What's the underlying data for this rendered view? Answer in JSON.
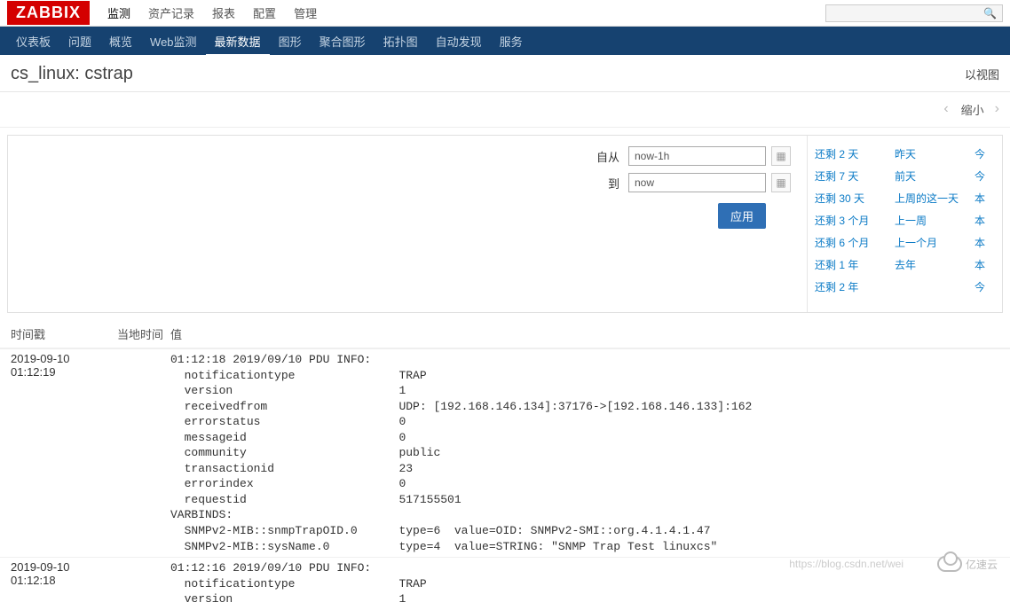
{
  "logo": "ZABBIX",
  "top_menu": [
    "监测",
    "资产记录",
    "报表",
    "配置",
    "管理"
  ],
  "top_active": 0,
  "sub_menu": [
    "仪表板",
    "问题",
    "概览",
    "Web监测",
    "最新数据",
    "图形",
    "聚合图形",
    "拓扑图",
    "自动发现",
    "服务"
  ],
  "sub_active": 4,
  "page_title": "cs_linux: cstrap",
  "view_mode": "以视图",
  "zoom_label": "缩小",
  "filter": {
    "from_label": "自从",
    "from_value": "now-1h",
    "to_label": "到",
    "to_value": "now",
    "apply": "应用"
  },
  "presets_left": [
    "还剩 2 天",
    "还剩 7 天",
    "还剩 30 天",
    "还剩 3 个月",
    "还剩 6 个月",
    "还剩 1 年",
    "还剩 2 年"
  ],
  "presets_right": [
    "昨天",
    "前天",
    "上周的这一天",
    "上一周",
    "上一个月",
    "去年",
    ""
  ],
  "presets_extra": [
    "今",
    "今",
    "本",
    "本",
    "本",
    "本",
    "今"
  ],
  "table": {
    "headers": {
      "ts": "时间戳",
      "local": "当地时间",
      "val": "值"
    },
    "rows": [
      {
        "ts": "2019-09-10 01:12:19",
        "local": "",
        "value": "01:12:18 2019/09/10 PDU INFO:\n  notificationtype               TRAP\n  version                        1\n  receivedfrom                   UDP: [192.168.146.134]:37176->[192.168.146.133]:162\n  errorstatus                    0\n  messageid                      0\n  community                      public\n  transactionid                  23\n  errorindex                     0\n  requestid                      517155501\nVARBINDS:\n  SNMPv2-MIB::snmpTrapOID.0      type=6  value=OID: SNMPv2-SMI::org.4.1.4.1.47\n  SNMPv2-MIB::sysName.0          type=4  value=STRING: \"SNMP Trap Test linuxcs\""
      },
      {
        "ts": "2019-09-10 01:12:18",
        "local": "",
        "value": "01:12:16 2019/09/10 PDU INFO:\n  notificationtype               TRAP\n  version                        1"
      }
    ]
  },
  "watermark": "https://blog.csdn.net/wei",
  "brand_watermark": "亿速云"
}
